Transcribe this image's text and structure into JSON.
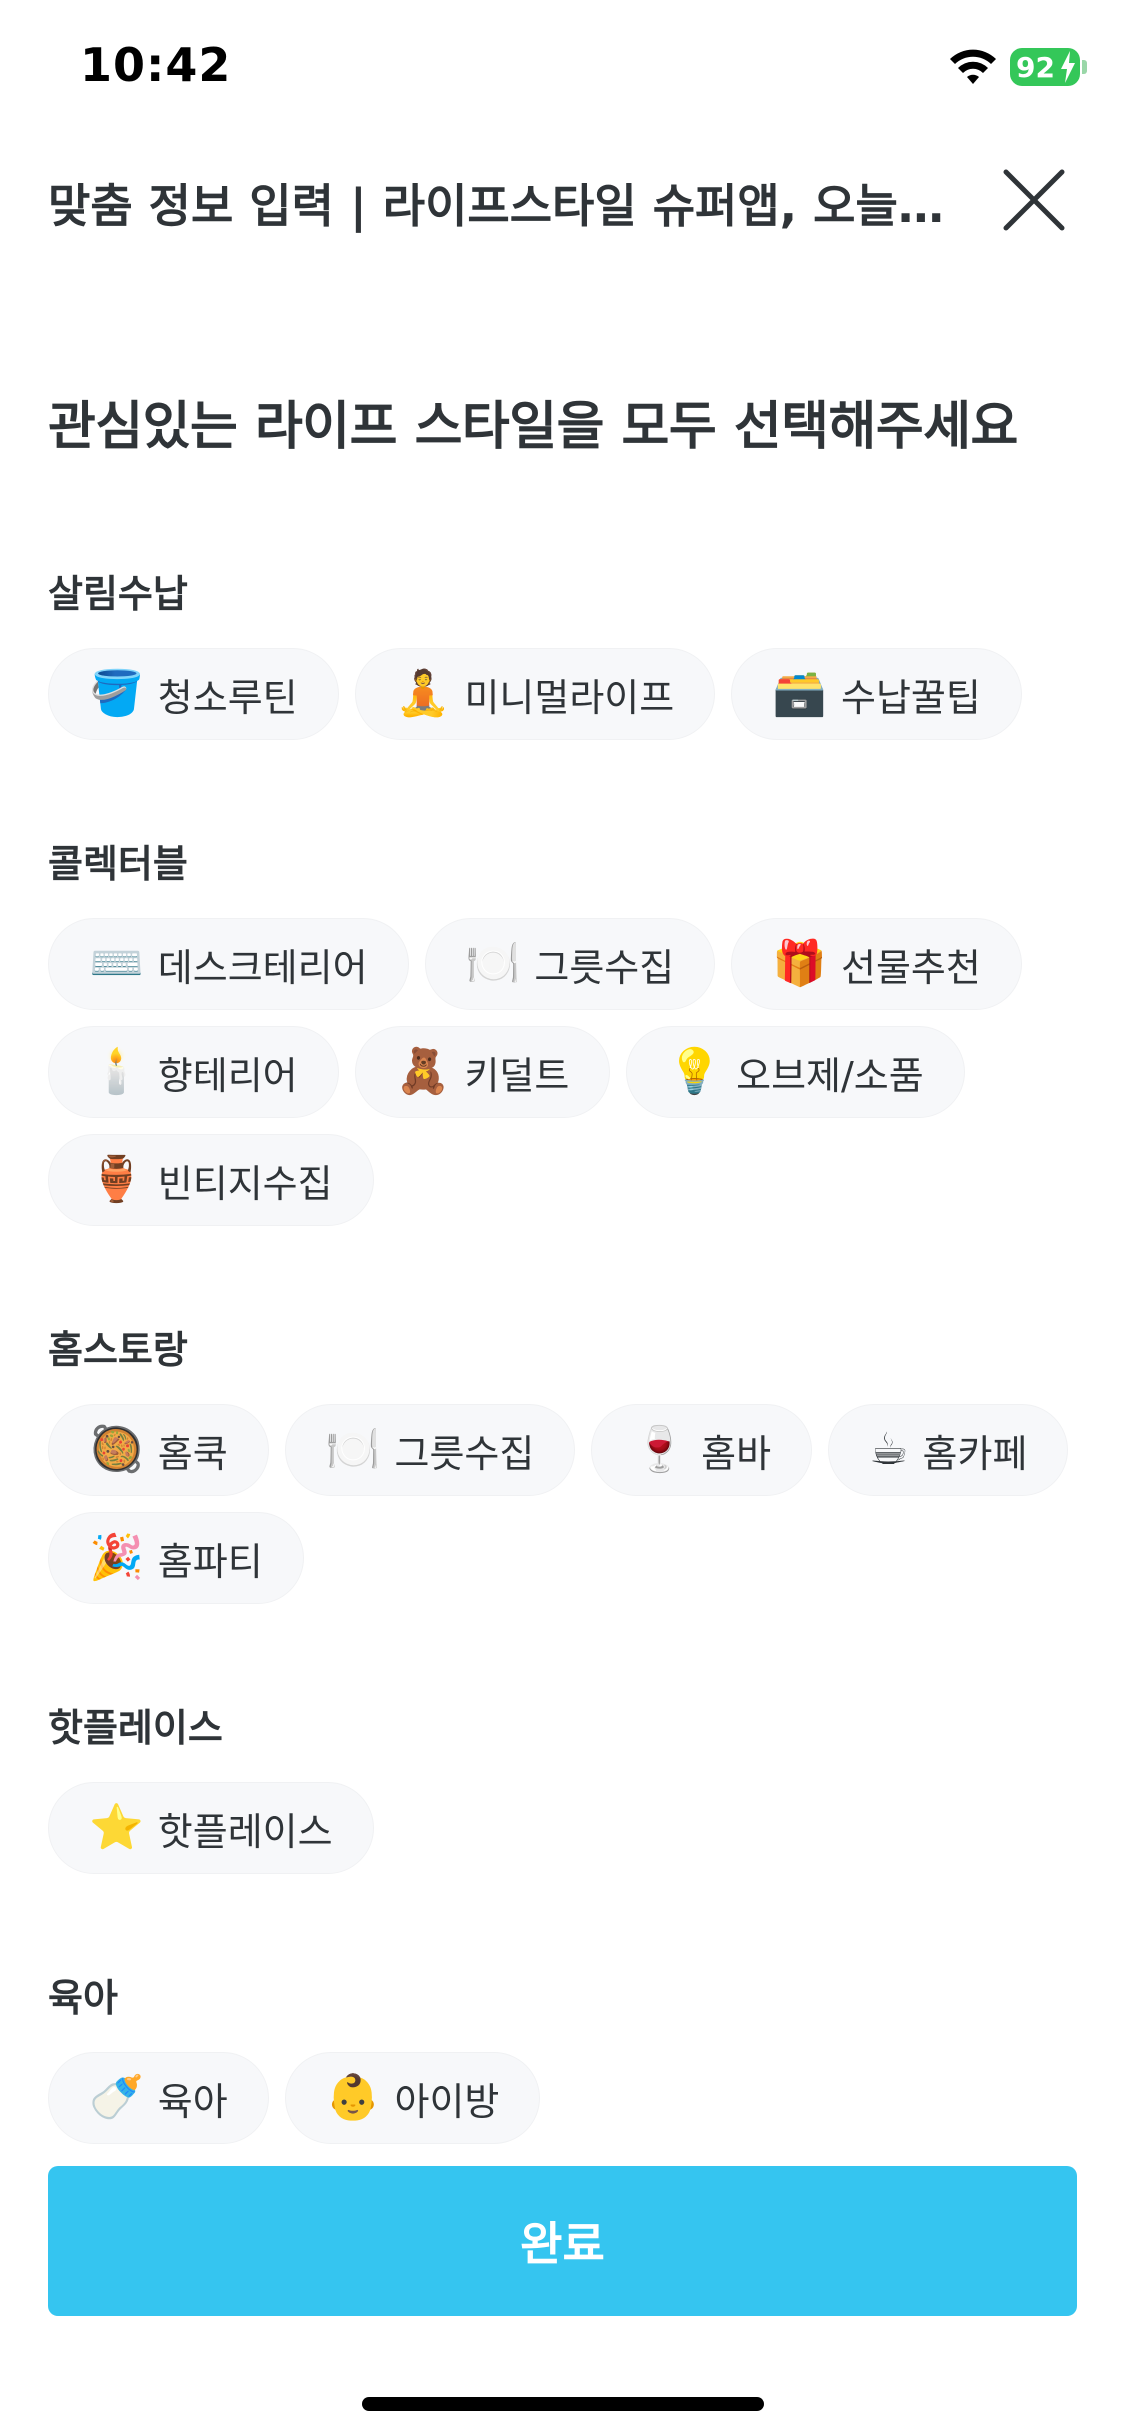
{
  "status_bar": {
    "time": "10:42",
    "battery": "92",
    "battery_color": "#34c759"
  },
  "header": {
    "title": "맞춤 정보 입력 | 라이프스타일 슈퍼앱, 오늘의집",
    "close_icon": "close-icon"
  },
  "page": {
    "heading": "관심있는 라이프 스타일을 모두 선택해주세요"
  },
  "sections": [
    {
      "title": "살림수납",
      "chips": [
        {
          "emoji": "🪣",
          "label": "청소루틴"
        },
        {
          "emoji": "🧘",
          "label": "미니멀라이프"
        },
        {
          "emoji": "🗃️",
          "label": "수납꿀팁"
        }
      ]
    },
    {
      "title": "콜렉터블",
      "chips": [
        {
          "emoji": "⌨️",
          "label": "데스크테리어"
        },
        {
          "emoji": "🍽️",
          "label": "그릇수집"
        },
        {
          "emoji": "🎁",
          "label": "선물추천"
        },
        {
          "emoji": "🕯️",
          "label": "향테리어"
        },
        {
          "emoji": "🧸",
          "label": "키덜트"
        },
        {
          "emoji": "💡",
          "label": "오브제/소품"
        },
        {
          "emoji": "🏺",
          "label": "빈티지수집"
        }
      ]
    },
    {
      "title": "홈스토랑",
      "chips": [
        {
          "emoji": "🥘",
          "label": "홈쿡"
        },
        {
          "emoji": "🍽️",
          "label": "그릇수집"
        },
        {
          "emoji": "🍷",
          "label": "홈바"
        },
        {
          "emoji": "☕",
          "label": "홈카페"
        },
        {
          "emoji": "🎉",
          "label": "홈파티"
        }
      ]
    },
    {
      "title": "핫플레이스",
      "chips": [
        {
          "emoji": "⭐",
          "label": "핫플레이스"
        }
      ]
    },
    {
      "title": "육아",
      "chips": [
        {
          "emoji": "🍼",
          "label": "육아"
        },
        {
          "emoji": "👶",
          "label": "아이방"
        }
      ]
    }
  ],
  "done_button": {
    "label": "완료",
    "color": "#35c5f0"
  }
}
